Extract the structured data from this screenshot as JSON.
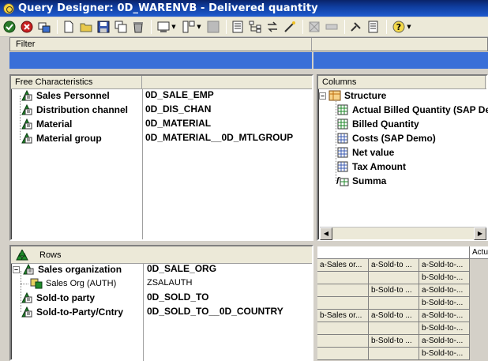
{
  "window": {
    "title": "Query Designer: 0D_WARENVB - Delivered quantity"
  },
  "toolbar": {
    "icons": [
      "check-icon",
      "cancel-icon",
      "properties-icon",
      "new-icon",
      "open-icon",
      "save-icon",
      "save-all-icon",
      "delete-icon",
      "display-dropdown-icon",
      "layout-dropdown-icon",
      "grid-icon",
      "table-icon",
      "hierarchy-icon",
      "exchange-icon",
      "wand-icon",
      "cells-disabled-icon",
      "link-disabled-icon",
      "tools-icon",
      "list-icon",
      "help-dropdown-icon"
    ]
  },
  "filter": {
    "header": "Filter"
  },
  "free_characteristics": {
    "header": "Free Characteristics",
    "items": [
      {
        "label": "Sales Personnel",
        "tech": "0D_SALE_EMP"
      },
      {
        "label": "Distribution channel",
        "tech": "0D_DIS_CHAN"
      },
      {
        "label": "Material",
        "tech": "0D_MATERIAL"
      },
      {
        "label": "Material group",
        "tech": "0D_MATERIAL__0D_MTLGROUP"
      }
    ]
  },
  "columns": {
    "header": "Columns",
    "structure_label": "Structure",
    "items": [
      {
        "label": "Actual Billed Quantity (SAP De"
      },
      {
        "label": "Billed Quantity"
      },
      {
        "label": "Costs (SAP Demo)"
      },
      {
        "label": "Net value"
      },
      {
        "label": "Tax Amount"
      },
      {
        "label": "Summa"
      }
    ]
  },
  "rows": {
    "header": "Rows",
    "items": [
      {
        "label": "Sales organization",
        "tech": "0D_SALE_ORG"
      },
      {
        "label": "Sales Org (AUTH)",
        "tech": "ZSALAUTH"
      },
      {
        "label": "Sold-to party",
        "tech": "0D_SOLD_TO"
      },
      {
        "label": "Sold-to-Party/Cntry",
        "tech": "0D_SOLD_TO__0D_COUNTRY"
      }
    ]
  },
  "preview": {
    "header": "Actu",
    "cells": [
      [
        "a-Sales or...",
        "a-Sold-to ...",
        "a-Sold-to-..."
      ],
      [
        "",
        "",
        "b-Sold-to-..."
      ],
      [
        "",
        "b-Sold-to ...",
        "a-Sold-to-..."
      ],
      [
        "",
        "",
        "b-Sold-to-..."
      ],
      [
        "b-Sales or...",
        "a-Sold-to ...",
        "a-Sold-to-..."
      ],
      [
        "",
        "",
        "b-Sold-to-..."
      ],
      [
        "",
        "b-Sold-to ...",
        "a-Sold-to-..."
      ],
      [
        "",
        "",
        "b-Sold-to-..."
      ]
    ]
  },
  "colors": {
    "title_bar": "#0a246a",
    "filter_strip": "#3a6fd8",
    "dimension_icon": "#1f8a2a",
    "structure_icon": "#e8a020"
  }
}
